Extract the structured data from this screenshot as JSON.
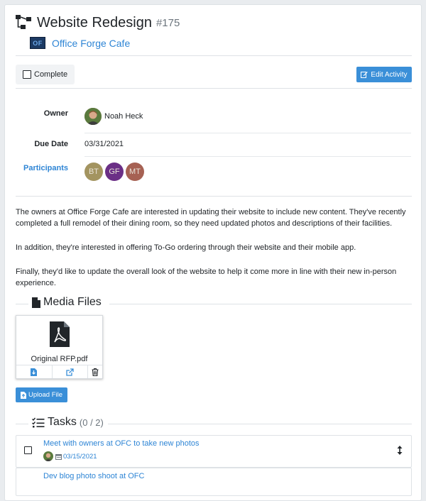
{
  "header": {
    "title": "Website Redesign",
    "number": "#175",
    "company_logo_text": "OF",
    "company_name": "Office Forge Cafe"
  },
  "toolbar": {
    "complete_label": "Complete",
    "edit_label": "Edit Activity"
  },
  "details": {
    "owner_label": "Owner",
    "owner_name": "Noah Heck",
    "due_date_label": "Due Date",
    "due_date": "03/31/2021",
    "participants_label": "Participants",
    "participants": [
      {
        "initials": "BT",
        "color": "#a39460"
      },
      {
        "initials": "GF",
        "color": "#6b2f86"
      },
      {
        "initials": "MT",
        "color": "#a66153"
      }
    ]
  },
  "description": {
    "p1": "The owners at Office Forge Cafe are interested in updating their website to include new content. They've recently completed a full remodel of their dining room, so they need updated photos and descriptions of their facilities.",
    "p2": "In addition, they're interested in offering To-Go ordering through their website and their mobile app.",
    "p3": "Finally, they'd like to update the overall look of the website to help it come more in line with their new in-person experience."
  },
  "media": {
    "heading": "Media Files",
    "file_name": "Original RFP.pdf",
    "upload_label": "Upload File"
  },
  "tasks": {
    "heading": "Tasks",
    "count": "(0 / 2)",
    "items": [
      {
        "title": "Meet with owners at OFC to take new photos",
        "date": "03/15/2021"
      },
      {
        "title": "Dev blog photo shoot at OFC",
        "date": ""
      }
    ]
  },
  "colors": {
    "accent": "#3a8fd8",
    "link": "#2e85d5"
  }
}
